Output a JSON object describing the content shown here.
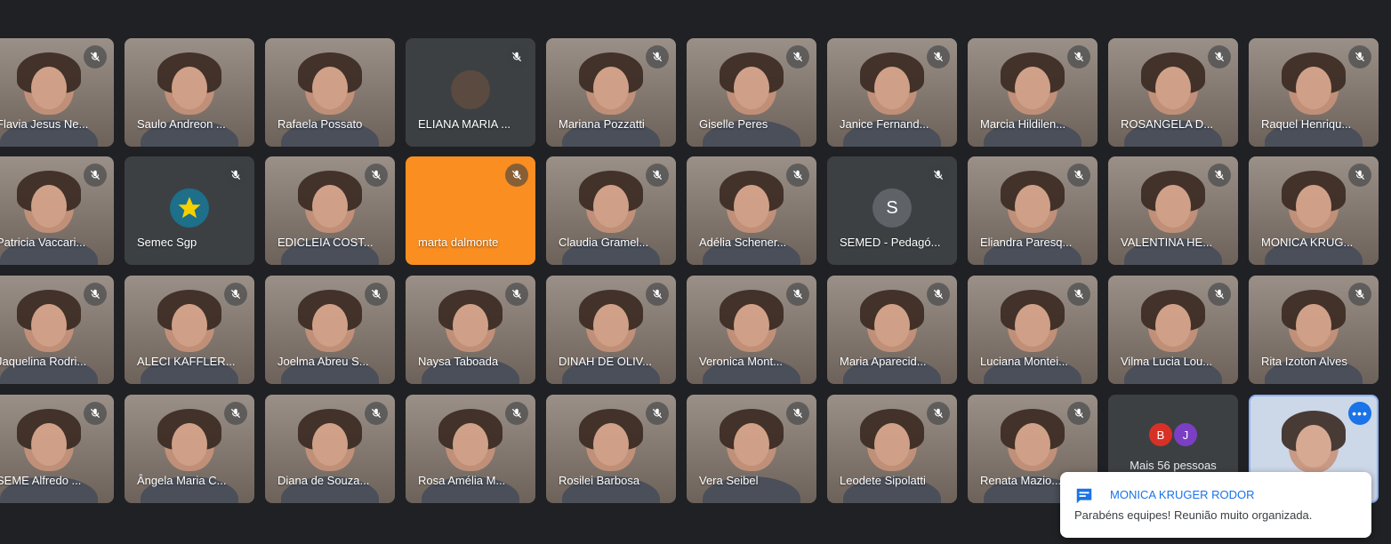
{
  "participants": [
    {
      "name": "Flavia Jesus Ne...",
      "muted": true,
      "type": "video"
    },
    {
      "name": "Saulo Andreon ...",
      "muted": false,
      "type": "video"
    },
    {
      "name": "Rafaela Possato",
      "muted": false,
      "type": "video"
    },
    {
      "name": "ELIANA MARIA ...",
      "muted": true,
      "type": "photo"
    },
    {
      "name": "Mariana Pozzatti",
      "muted": true,
      "type": "video"
    },
    {
      "name": "Giselle Peres",
      "muted": true,
      "type": "video"
    },
    {
      "name": "Janice Fernand...",
      "muted": true,
      "type": "video"
    },
    {
      "name": "Marcia Hildilen...",
      "muted": true,
      "type": "video"
    },
    {
      "name": "ROSANGELA D...",
      "muted": true,
      "type": "video"
    },
    {
      "name": "Raquel Henriqu...",
      "muted": true,
      "type": "video"
    },
    {
      "name": "Patricia Vaccari...",
      "muted": true,
      "type": "video"
    },
    {
      "name": "Semec Sgp",
      "muted": true,
      "type": "emblem"
    },
    {
      "name": "EDICLEIA COST...",
      "muted": true,
      "type": "video"
    },
    {
      "name": "marta dalmonte",
      "muted": true,
      "type": "orange"
    },
    {
      "name": "Claudia Gramel...",
      "muted": true,
      "type": "video"
    },
    {
      "name": "Adélia Schener...",
      "muted": true,
      "type": "video"
    },
    {
      "name": "SEMED - Pedagó...",
      "muted": true,
      "type": "letter",
      "letter": "S"
    },
    {
      "name": "Eliandra Paresq...",
      "muted": true,
      "type": "video"
    },
    {
      "name": "VALENTINA HE...",
      "muted": true,
      "type": "video"
    },
    {
      "name": "MONICA KRUG...",
      "muted": true,
      "type": "video"
    },
    {
      "name": "Jaquelina Rodri...",
      "muted": true,
      "type": "video"
    },
    {
      "name": "ALECI KAFFLER...",
      "muted": true,
      "type": "video"
    },
    {
      "name": "Joelma Abreu S...",
      "muted": true,
      "type": "video"
    },
    {
      "name": "Naysa Taboada",
      "muted": true,
      "type": "video"
    },
    {
      "name": "DINAH DE OLIV...",
      "muted": true,
      "type": "video"
    },
    {
      "name": "Veronica Mont...",
      "muted": true,
      "type": "video"
    },
    {
      "name": "Maria Aparecid...",
      "muted": true,
      "type": "video"
    },
    {
      "name": "Luciana Montei...",
      "muted": true,
      "type": "video"
    },
    {
      "name": "Vilma Lucia Lou...",
      "muted": true,
      "type": "video"
    },
    {
      "name": "Rita Izoton Alves",
      "muted": true,
      "type": "video"
    },
    {
      "name": "SEME Alfredo ...",
      "muted": true,
      "type": "video"
    },
    {
      "name": "Ângela Maria C...",
      "muted": true,
      "type": "video"
    },
    {
      "name": "Diana de Souza...",
      "muted": true,
      "type": "video"
    },
    {
      "name": "Rosa Amélia M...",
      "muted": true,
      "type": "video"
    },
    {
      "name": "Rosilei Barbosa",
      "muted": true,
      "type": "video"
    },
    {
      "name": "Vera Seibel",
      "muted": true,
      "type": "video"
    },
    {
      "name": "Leodete Sipolatti",
      "muted": true,
      "type": "video"
    },
    {
      "name": "Renata Mazio...",
      "muted": true,
      "type": "video"
    }
  ],
  "more_tile": {
    "label": "Mais 56 pessoas",
    "avatars": [
      {
        "letter": "B",
        "color": "#d93025"
      },
      {
        "letter": "J",
        "color": "#7b3fc4"
      }
    ]
  },
  "self_tile": {
    "menu": "•••"
  },
  "toast": {
    "sender": "MONICA KRUGER RODOR",
    "message": "Parabéns equipes! Reunião muito organizada."
  },
  "colors": {
    "background": "#202124",
    "tile": "#3c4043",
    "orange": "#fa8e21",
    "accent": "#1a73e8"
  }
}
